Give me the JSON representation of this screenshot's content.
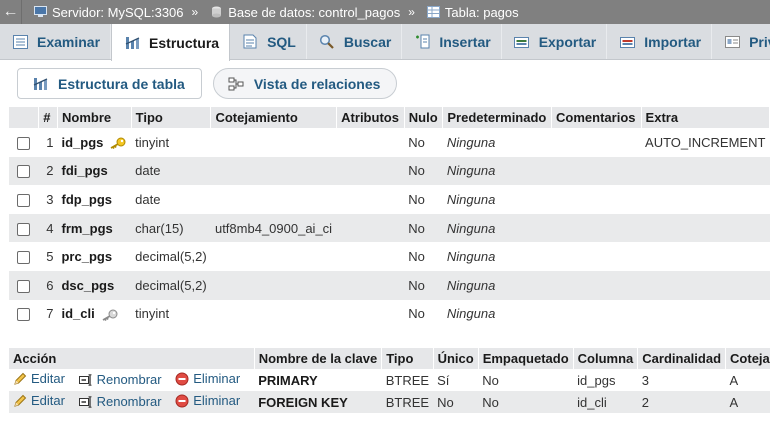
{
  "breadcrumb": {
    "server": "Servidor: MySQL:3306",
    "database": "Base de datos: control_pagos",
    "table": "Tabla: pagos",
    "separator": "»"
  },
  "tabs": [
    {
      "label": "Examinar",
      "icon": "browse-icon",
      "active": false
    },
    {
      "label": "Estructura",
      "icon": "structure-icon",
      "active": true
    },
    {
      "label": "SQL",
      "icon": "sql-icon",
      "active": false
    },
    {
      "label": "Buscar",
      "icon": "search-icon",
      "active": false
    },
    {
      "label": "Insertar",
      "icon": "insert-icon",
      "active": false
    },
    {
      "label": "Exportar",
      "icon": "export-icon",
      "active": false
    },
    {
      "label": "Importar",
      "icon": "import-icon",
      "active": false
    },
    {
      "label": "Privile",
      "icon": "privileges-icon",
      "active": false
    }
  ],
  "subnav": {
    "table_structure": "Estructura de tabla",
    "relation_view": "Vista de relaciones"
  },
  "structure": {
    "headers": [
      "#",
      "Nombre",
      "Tipo",
      "Cotejamiento",
      "Atributos",
      "Nulo",
      "Predeterminado",
      "Comentarios",
      "Extra"
    ],
    "rows": [
      {
        "num": "1",
        "name": "id_pgs",
        "key": "primary",
        "type": "tinyint",
        "collation": "",
        "attributes": "",
        "null": "No",
        "default": "Ninguna",
        "comments": "",
        "extra": "AUTO_INCREMENT"
      },
      {
        "num": "2",
        "name": "fdi_pgs",
        "key": "",
        "type": "date",
        "collation": "",
        "attributes": "",
        "null": "No",
        "default": "Ninguna",
        "comments": "",
        "extra": ""
      },
      {
        "num": "3",
        "name": "fdp_pgs",
        "key": "",
        "type": "date",
        "collation": "",
        "attributes": "",
        "null": "No",
        "default": "Ninguna",
        "comments": "",
        "extra": ""
      },
      {
        "num": "4",
        "name": "frm_pgs",
        "key": "",
        "type": "char(15)",
        "collation": "utf8mb4_0900_ai_ci",
        "attributes": "",
        "null": "No",
        "default": "Ninguna",
        "comments": "",
        "extra": ""
      },
      {
        "num": "5",
        "name": "prc_pgs",
        "key": "",
        "type": "decimal(5,2)",
        "collation": "",
        "attributes": "",
        "null": "No",
        "default": "Ninguna",
        "comments": "",
        "extra": ""
      },
      {
        "num": "6",
        "name": "dsc_pgs",
        "key": "",
        "type": "decimal(5,2)",
        "collation": "",
        "attributes": "",
        "null": "No",
        "default": "Ninguna",
        "comments": "",
        "extra": ""
      },
      {
        "num": "7",
        "name": "id_cli",
        "key": "foreign",
        "type": "tinyint",
        "collation": "",
        "attributes": "",
        "null": "No",
        "default": "Ninguna",
        "comments": "",
        "extra": ""
      }
    ]
  },
  "indexes": {
    "headers": [
      "Acción",
      "Nombre de la clave",
      "Tipo",
      "Único",
      "Empaquetado",
      "Columna",
      "Cardinalidad",
      "Coteja"
    ],
    "actions": {
      "edit": "Editar",
      "rename": "Renombrar",
      "delete": "Eliminar"
    },
    "rows": [
      {
        "key_name": "PRIMARY",
        "type": "BTREE",
        "unique": "Sí",
        "packed": "No",
        "column": "id_pgs",
        "cardinality": "3",
        "collation": "A"
      },
      {
        "key_name": "FOREIGN KEY",
        "type": "BTREE",
        "unique": "No",
        "packed": "No",
        "column": "id_cli",
        "cardinality": "2",
        "collation": "A"
      }
    ]
  },
  "colors": {
    "link": "#235a81",
    "breadcrumb_bg": "#808080",
    "tab_bg": "#dadde1",
    "row_alt": "#e9eaeb",
    "primary_key": "#e8b400",
    "foreign_key": "#9a9a9a",
    "delete_red": "#d9302c"
  }
}
